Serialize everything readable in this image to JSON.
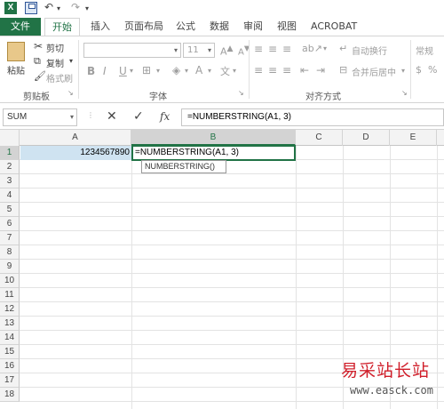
{
  "quick_access": {
    "undo_glyph": "↶",
    "redo_glyph": "↷"
  },
  "tabs": [
    {
      "label": "文件"
    },
    {
      "label": "开始"
    },
    {
      "label": "插入"
    },
    {
      "label": "页面布局"
    },
    {
      "label": "公式"
    },
    {
      "label": "数据"
    },
    {
      "label": "审阅"
    },
    {
      "label": "视图"
    },
    {
      "label": "ACROBAT"
    }
  ],
  "ribbon": {
    "clipboard": {
      "paste_label": "粘贴",
      "cut_label": "剪切",
      "copy_label": "复制",
      "format_painter_label": "格式刷",
      "group_label": "剪贴板"
    },
    "font": {
      "font_size": "11",
      "group_label": "字体",
      "bold": "B",
      "italic": "I",
      "underline": "U"
    },
    "alignment": {
      "wrap_text_label": "自动换行",
      "merge_center_label": "合并后居中",
      "group_label": "对齐方式"
    },
    "number": {
      "format_label": "常规"
    }
  },
  "formula_bar": {
    "name_box": "SUM",
    "cancel_glyph": "✕",
    "enter_glyph": "✓",
    "fx_label": "fx",
    "formula": "=NUMBERSTRING(A1, 3)"
  },
  "sheet": {
    "columns": [
      "A",
      "B",
      "C",
      "D",
      "E"
    ],
    "rows": [
      "1",
      "2",
      "3",
      "4",
      "5",
      "6",
      "7",
      "8",
      "9",
      "10",
      "11",
      "12",
      "13",
      "14",
      "15",
      "16",
      "17",
      "18"
    ],
    "cell_a1": "1234567890",
    "cell_b1": "=NUMBERSTRING(A1, 3)",
    "tooltip": "NUMBERSTRING()"
  },
  "watermark": {
    "title": "易采站长站",
    "url": "www.easck.com"
  },
  "colors": {
    "accent": "#217346",
    "selection": "#cfe3f1",
    "watermark_red": "#d01e2a"
  }
}
